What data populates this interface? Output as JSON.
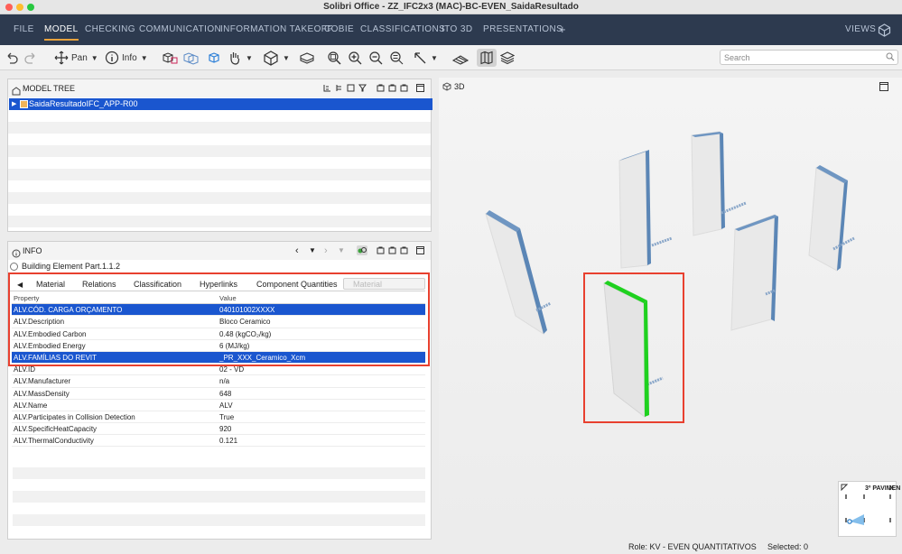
{
  "window": {
    "title": "Solibri Office - ZZ_IFC2x3 (MAC)-BC-EVEN_SaidaResultado",
    "traffic_colors": [
      "#ff5f57",
      "#febc2e",
      "#28c840"
    ]
  },
  "menu": {
    "items": [
      "FILE",
      "MODEL",
      "CHECKING",
      "COMMUNICATION",
      "INFORMATION TAKEOFF",
      "COBIE",
      "CLASSIFICATIONS",
      "ITO 3D",
      "PRESENTATIONS"
    ],
    "active": "MODEL",
    "plus": "+",
    "views": "VIEWS"
  },
  "toolbar": {
    "pan_label": "Pan",
    "info_label": "Info",
    "search_placeholder": "Search"
  },
  "model_tree": {
    "title": "MODEL TREE",
    "root_item": "SaidaResultadoIFC_APP-R00"
  },
  "info": {
    "title": "INFO",
    "element_name": "Building Element Part.1.1.2",
    "tabs": [
      "Material",
      "Relations",
      "Classification",
      "Hyperlinks",
      "Component Quantities",
      "Material Properties"
    ],
    "active_tab": "Material Properties",
    "table": {
      "headers": [
        "Property",
        "Value"
      ],
      "rows": [
        {
          "key": "ALV.CÓD. CARGA ORÇAMENTO",
          "value": "040101002XXXX",
          "selected": true
        },
        {
          "key": "ALV.Description",
          "value": "Bloco Ceramico",
          "selected": false
        },
        {
          "key": "ALV.Embodied Carbon",
          "value": "0.48 (kgCO₂/kg)",
          "selected": false
        },
        {
          "key": "ALV.Embodied Energy",
          "value": "6 (MJ/kg)",
          "selected": false
        },
        {
          "key": "ALV.FAMÍLIAS DO REVIT",
          "value": "_PR_XXX_Ceramico_Xcm",
          "selected": true
        },
        {
          "key": "ALV.ID",
          "value": "02 - VD",
          "selected": false
        },
        {
          "key": "ALV.Manufacturer",
          "value": "n/a",
          "selected": false
        },
        {
          "key": "ALV.MassDensity",
          "value": "648",
          "selected": false
        },
        {
          "key": "ALV.Name",
          "value": "ALV",
          "selected": false
        },
        {
          "key": "ALV.Participates in Collision Detection",
          "value": "True",
          "selected": false
        },
        {
          "key": "ALV.SpecificHeatCapacity",
          "value": "920",
          "selected": false
        },
        {
          "key": "ALV.ThermalConductivity",
          "value": "0.121",
          "selected": false
        }
      ]
    }
  },
  "view3d": {
    "title": "3D",
    "highlight_color": "#e8402f",
    "selected_edge_color": "#1fd11f",
    "wall_edge_color": "#5b86b6"
  },
  "minimap": {
    "label": "3º PAVIMEN"
  },
  "status": {
    "role": "Role: KV - EVEN QUANTITATIVOS",
    "selected": "Selected: 0"
  }
}
